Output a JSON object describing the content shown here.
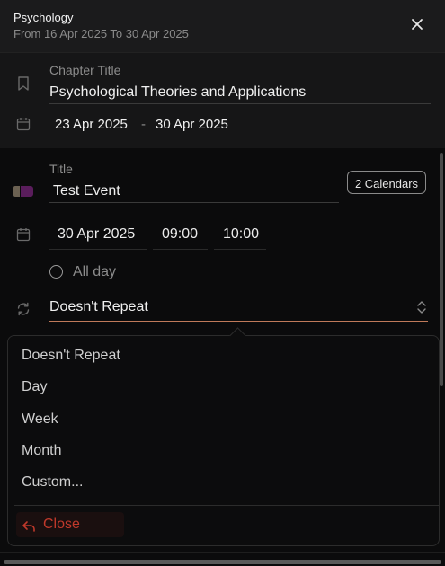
{
  "header": {
    "title": "Psychology",
    "subtitle": "From 16 Apr 2025 To 30 Apr 2025",
    "close_icon": "close-icon"
  },
  "chapter": {
    "label": "Chapter Title",
    "title": "Psychological Theories and Applications",
    "start_date": "23 Apr 2025",
    "separator": "-",
    "end_date": "30 Apr 2025",
    "bookmark_icon": "bookmark-icon",
    "calendar_icon": "calendar-icon"
  },
  "event": {
    "title_label": "Title",
    "title_value": "Test Event",
    "calendars_button": "2 Calendars",
    "date": "30 Apr 2025",
    "start_time": "09:00",
    "end_time": "10:00",
    "all_day_label": "All day",
    "repeat_value": "Doesn't Repeat",
    "color_swatch": [
      "#6b6152",
      "#5a1d5c"
    ]
  },
  "repeat_dropdown": {
    "options": [
      "Doesn't Repeat",
      "Day",
      "Week",
      "Month",
      "Custom..."
    ],
    "close_label": "Close",
    "close_color": "#c0392b"
  },
  "colors": {
    "accent": "#c07a5a",
    "background": "#0f0f10",
    "danger": "#c0392b"
  }
}
